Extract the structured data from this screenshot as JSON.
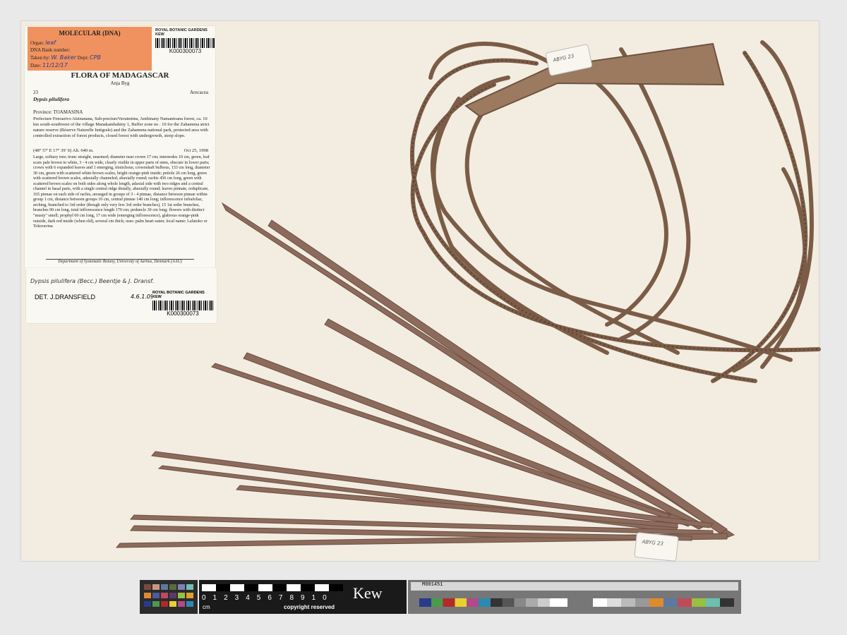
{
  "label": {
    "molecular_title": "MOLECULAR (DNA)",
    "organ_label": "Organ:",
    "organ_value": "leaf",
    "dna_bank_label": "DNA Bank number:",
    "taken_by_label": "Taken by:",
    "taken_by_value": "W. Baker",
    "dept_label": "Dept:",
    "dept_value": "CPB",
    "date_label": "Date:",
    "date_value": "11/12/17",
    "kew_header": "ROYAL BOTANIC GARDENS KEW",
    "barcode_number": "K000300073",
    "flora_title": "FLORA OF MADAGASCAR",
    "collector": "Anja Byg",
    "collection_number": "23",
    "family": "Arecacea",
    "species": "Dypsis   pilulifera",
    "province": "Province: TOAMASINA",
    "locality": "Prefecture Fenoarivo Atsinanana, Sub-prectureVavatenina, Ambinany Namantoana forest, ca. 10 km south-southwest of the village Manakambahiny 1, Buffer zone no . 10 for the Zahamena strict nature reserve (Réserve Naturelle Intégrale) and the Zahamena national park, protected area with controlled extraction of forest products, closed forest with undergrowth, steep slope.",
    "coords": "(48° 57' E  17° 39' S)  Alt. 640 m.",
    "date": "Oct 25, 1998",
    "description": "Large, solitary tree; trunc straight, unarmed; diameter near crown 17 cm; internodes 10 cm, green, leaf scars pale brown to white, 3 - 4 cm wide, clearly visible in upper parts of stem, obscure in lower parts; crown with 6 expanded leaves and 1 emerging, tristichous; crownshaft bulbous, 133 cm long, diameter 30 cm, green with scattered white-brown scales, bright orange-pink inside; petiole 26 cm long, green with scattered brown scales, adaxially channeled, abaxially round; rachis 456 cm long, green with scattered brown scales on both sides along whole length, adaxial side with two ridges and a central channel in basal parts, with a single central ridge distally, abaxially round; leaves pinnate, reduplicate, 165 pinnae on each side of rachis, arranged in groups of 3 - 4 pinnae, distance between pinnae within group 1 cm, distance between groups 10 cm, central pinnae 140 cm long; inflorescence infrafoliar, arching, branched to 3rd order (though only very few 3rd order branches), 15 1st order branches, branches 90 cm long, total inflorescence length 170 cm; peduncle 30 cm long; flowers with distinct \"musty\" smell; prophyl 60 cm long, 17 cm wide (emerging inflorescence), glabrous orange-pink outside, dark red inside (when old), several cm thick; uses: palm heart eaten; local name: Lafatoko or Tokoravina",
    "department": "Department of Systematic Botany, University of Aarhus, Denmark (AAU)"
  },
  "determination": {
    "handwritten_name": "Dypsis pilulifera (Becc.) Beentje & J. Dransf.",
    "det_by": "DET. J.DRANSFIELD",
    "det_date": "4.6.1.09",
    "kew_header": "ROYAL BOTANIC GARDENS KEW",
    "barcode_number": "K000300073"
  },
  "tags": {
    "tag1": "ABYG 23",
    "tag2": "ABYG 23"
  },
  "colorcard": {
    "ruler_numbers": "012345678910",
    "unit": "cm",
    "copyright": "copyright reserved",
    "logo": "Kew",
    "strip_text": "M001451"
  },
  "colors": {
    "sheet": "#f2ede0",
    "stem": "#8a6a52",
    "leaf": "#8d6b5c",
    "orange_label": "#f0925f"
  }
}
